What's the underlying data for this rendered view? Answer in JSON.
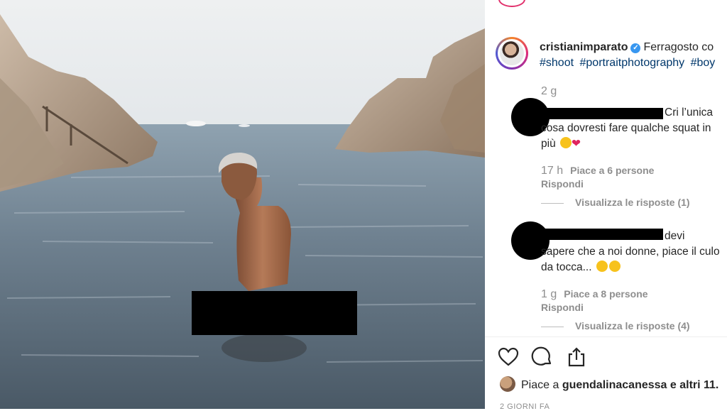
{
  "post": {
    "username": "cristianimparato",
    "verified_icon": "verified-badge-icon",
    "caption_start": "Ferragosto co",
    "hashtags": [
      "#shoot",
      "#portraitphotography",
      "#boy"
    ],
    "caption_time": "2 g"
  },
  "comments": [
    {
      "text_line1": "Cri l’unica",
      "text_rest": "cosa dovresti fare qualche squat in più",
      "emojis": [
        "laughing-tears-emoji",
        "red-heart-emoji"
      ],
      "time": "17 h",
      "likes": "Piace a 6 persone",
      "reply": "Rispondi",
      "view_replies": "Visualizza le risposte (1)"
    },
    {
      "text_line1": "devi",
      "text_rest": "sapere che a noi donne, piace il culo da tocca...",
      "emojis": [
        "tongue-wink-emoji",
        "tongue-wink-emoji"
      ],
      "time": "1 g",
      "likes": "Piace a 8 persone",
      "reply": "Rispondi",
      "view_replies": "Visualizza le risposte (4)"
    }
  ],
  "likes_line": {
    "prefix": "Piace a ",
    "user": "guendalinacanessa",
    "suffix": " e altri 11."
  },
  "post_time": "2 GIORNI FA",
  "icons": [
    "heart-icon",
    "comment-icon",
    "share-icon"
  ],
  "colors": {
    "link": "#00376b",
    "muted": "#8e8e8e",
    "verified": "#3897f0"
  }
}
